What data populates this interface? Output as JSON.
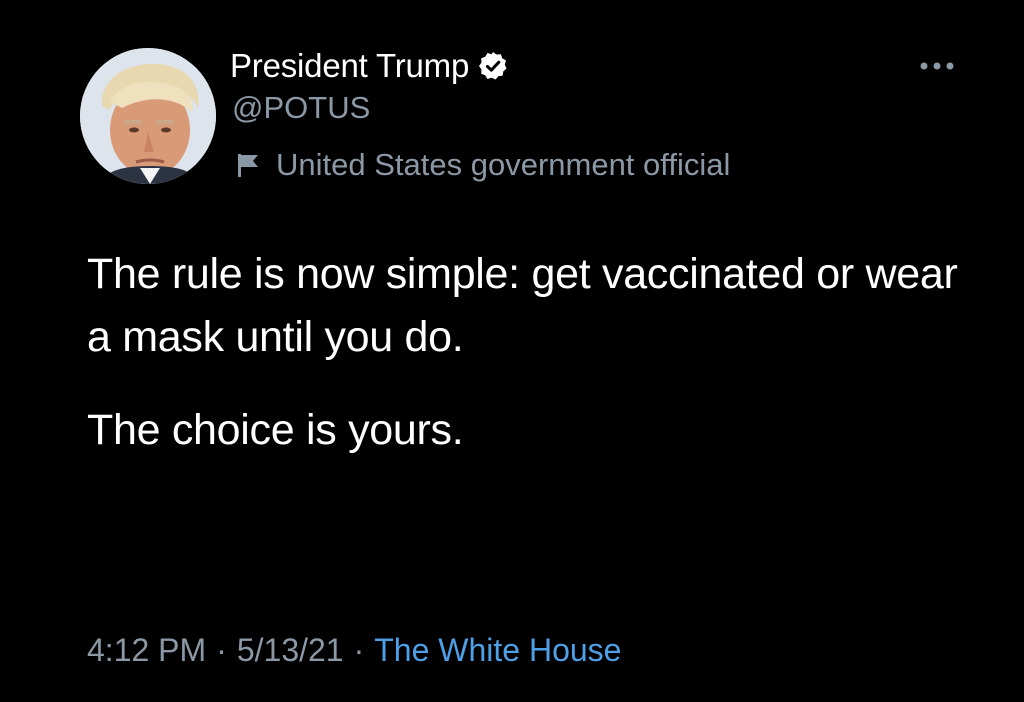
{
  "tweet": {
    "author": {
      "display_name": "President Trump",
      "handle": "@POTUS",
      "verified": true,
      "label": "United States government official"
    },
    "text_paragraphs": [
      "The rule is now simple: get vaccinated or wear a mask until you do.",
      "The choice is yours."
    ],
    "time": "4:12 PM",
    "date": "5/13/21",
    "separator": "·",
    "source": "The White House"
  },
  "icons": {
    "verified": "verified-badge-icon",
    "flag": "flag-icon",
    "more": "more-options-icon"
  },
  "colors": {
    "background": "#000000",
    "primary_text": "#ffffff",
    "secondary_text": "#8b98a5",
    "link": "#4f9fe6"
  }
}
